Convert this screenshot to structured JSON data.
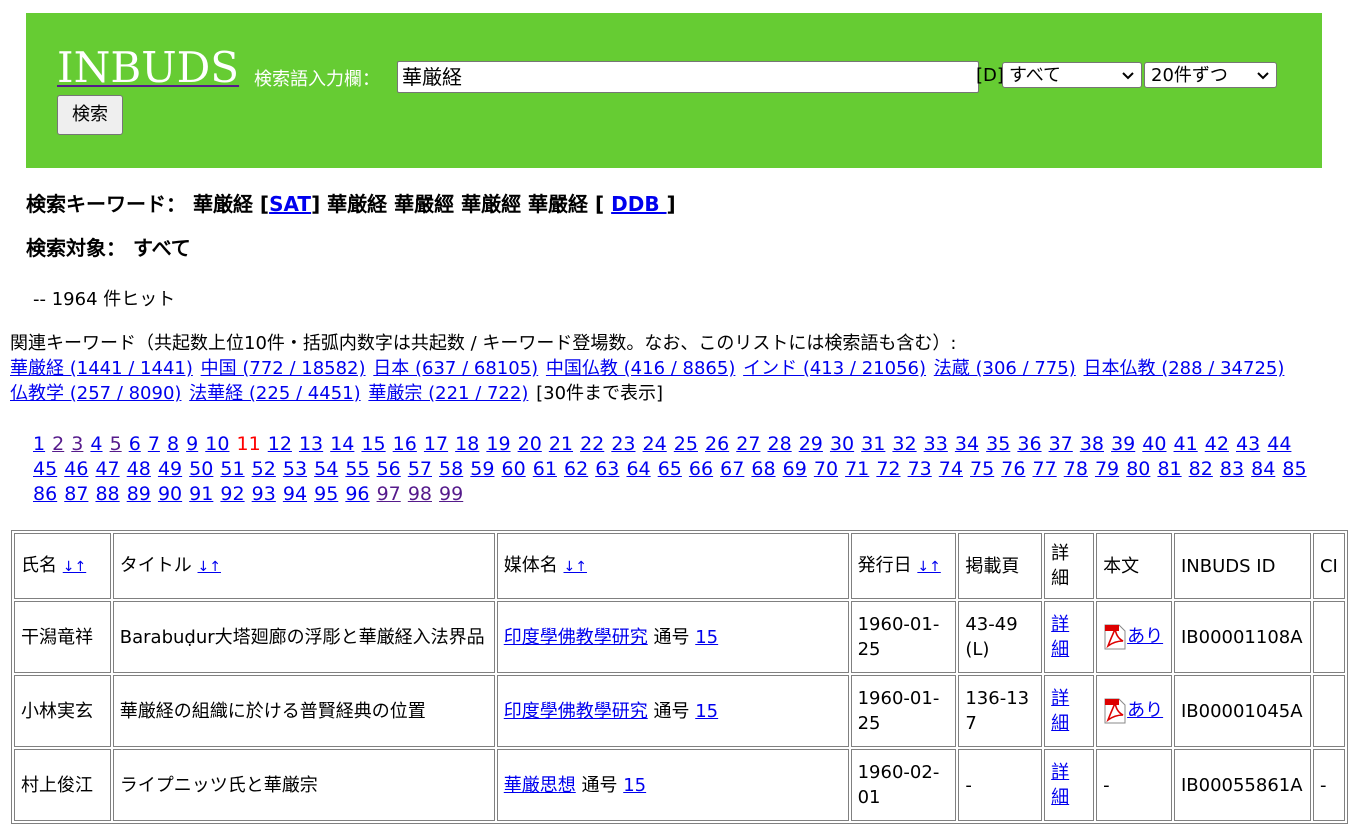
{
  "header": {
    "logo": "INBUDS",
    "search_label": "検索語入力欄：",
    "search_value": "華厳経",
    "d_label": "[D]",
    "target_select": "すべて",
    "count_select": "20件ずつ",
    "search_button": "検索"
  },
  "keywords": {
    "label": "検索キーワード： 華厳経 [",
    "sat": "SAT",
    "mid": "] 華厳経 華嚴經 華厳經 華嚴経 [ ",
    "ddb": "DDB ",
    "end": "]"
  },
  "target": "検索対象： すべて",
  "hits": "-- 1964 件ヒット",
  "related": {
    "label": "関連キーワード（共起数上位10件・括弧内数字は共起数 / キーワード登場数。なお、このリストには検索語も含む）:",
    "items": [
      "華厳経 (1441 / 1441)",
      "中国 (772 / 18582)",
      "日本 (637 / 68105)",
      "中国仏教 (416 / 8865)",
      "インド (413 / 21056)",
      "法蔵 (306 / 775)",
      "日本仏教 (288 / 34725)",
      "仏教学 (257 / 8090)",
      "法華経 (225 / 4451)",
      "華厳宗 (221 / 722)"
    ],
    "more": "[30件まで表示]"
  },
  "pager": {
    "current": "11",
    "visited": [
      "2",
      "3",
      "5",
      "97",
      "98",
      "99"
    ]
  },
  "table": {
    "headers": {
      "author": "氏名",
      "title": "タイトル",
      "media": "媒体名",
      "date": "発行日",
      "pages": "掲載頁",
      "detail": "詳細",
      "body": "本文",
      "id": "INBUDS ID",
      "ci": "CI"
    },
    "sort_glyph": "↓↑",
    "rows": [
      {
        "author": "干潟竜祥",
        "title": "Barabuḍur大塔廻廊の浮彫と華厳経入法界品",
        "media": "印度學佛教學研究",
        "issue_label": "通号",
        "issue": "15",
        "date": "1960-01-25",
        "pages": "43-49(L)",
        "detail": "詳細",
        "body": "あり",
        "has_pdf": true,
        "id": "IB00001108A",
        "ci": ""
      },
      {
        "author": "小林実玄",
        "title": "華厳経の組織に於ける普賢経典の位置",
        "media": "印度學佛教學研究",
        "issue_label": "通号",
        "issue": "15",
        "date": "1960-01-25",
        "pages": "136-137",
        "detail": "詳細",
        "body": "あり",
        "has_pdf": true,
        "id": "IB00001045A",
        "ci": ""
      },
      {
        "author": "村上俊江",
        "title": "ライプニッツ氏と華厳宗",
        "media": "華厳思想",
        "issue_label": "通号",
        "issue": "15",
        "date": "1960-02-01",
        "pages": "-",
        "detail": "詳細",
        "body": "-",
        "has_pdf": false,
        "id": "IB00055861A",
        "ci": "-"
      }
    ]
  }
}
